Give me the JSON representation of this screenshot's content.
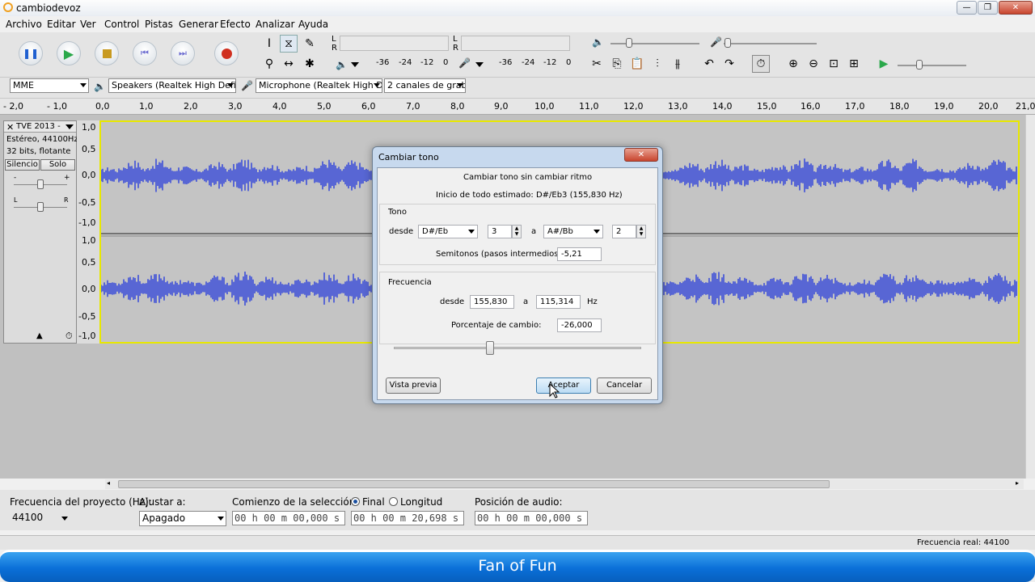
{
  "window": {
    "title": "cambiodevoz",
    "min": "—",
    "max": "❐",
    "close": "✕"
  },
  "menu": [
    "Archivo",
    "Editar",
    "Ver",
    "Control",
    "Pistas",
    "Generar",
    "Efecto",
    "Analizar",
    "Ayuda"
  ],
  "meters": {
    "play_ticks": [
      "-36",
      "-24",
      "-12",
      "0"
    ],
    "rec_ticks": [
      "-36",
      "-24",
      "-12",
      "0"
    ],
    "L": "L",
    "R": "R"
  },
  "device_bar": {
    "host": "MME",
    "speakers": "Speakers (Realtek High Definit",
    "microphone": "Microphone (Realtek High Defi",
    "channels": "2 canales de grab"
  },
  "ruler": [
    "- 2,0",
    "- 1,0",
    "0,0",
    "1,0",
    "2,0",
    "3,0",
    "4,0",
    "5,0",
    "6,0",
    "7,0",
    "8,0",
    "9,0",
    "10,0",
    "11,0",
    "12,0",
    "13,0",
    "14,0",
    "15,0",
    "16,0",
    "17,0",
    "18,0",
    "19,0",
    "20,0",
    "21,0"
  ],
  "track": {
    "name": "TVE 2013 -",
    "info1": "Estéreo, 44100Hz",
    "info2": "32 bits, flotante",
    "mute": "Silencio",
    "solo": "Solo",
    "gain_minus": "-",
    "gain_plus": "+",
    "pan_L": "L",
    "pan_R": "R",
    "scale": [
      "1,0",
      "0,5",
      "0,0",
      "-0,5",
      "-1,0",
      "1,0",
      "0,5",
      "0,0",
      "-0,5",
      "-1,0"
    ]
  },
  "dialog": {
    "title": "Cambiar tono",
    "heading": "Cambiar tono sin cambiar ritmo",
    "estimated": "Inicio de todo estimado: D#/Eb3 (155,830 Hz)",
    "tono": "Tono",
    "desde": "desde",
    "from_note": "D#/Eb",
    "from_oct": "3",
    "a": "a",
    "to_note": "A#/Bb",
    "to_oct": "2",
    "semitones_label": "Semitonos (pasos intermedios):",
    "semitones": "-5,21",
    "frecuencia": "Frecuencia",
    "freq_from": "155,830",
    "freq_to": "115,314",
    "hz": "Hz",
    "percent_label": "Porcentaje de cambio:",
    "percent": "-26,000",
    "preview": "Vista previa",
    "ok": "Aceptar",
    "cancel": "Cancelar",
    "slider_value": 0.39
  },
  "bottom": {
    "rate_label": "Frecuencia del proyecto (Hz):",
    "rate": "44100",
    "snap_label": "Ajustar a:",
    "snap": "Apagado",
    "sel_start_label": "Comienzo de la selección:",
    "final": "Final",
    "longitud": "Longitud",
    "sel_start": "00 h 00 m 00,000 s",
    "sel_end": "00 h 00 m 20,698 s",
    "audio_pos_label": "Posición de audio:",
    "audio_pos": "00 h 00 m 00,000 s"
  },
  "status": {
    "actual_rate": "Frecuencia real: 44100"
  },
  "banner": "Fan of Fun",
  "colors": {
    "wave": "#3d4fd8",
    "banner": "#0a6fd8",
    "selection_border": "#e8e800"
  }
}
